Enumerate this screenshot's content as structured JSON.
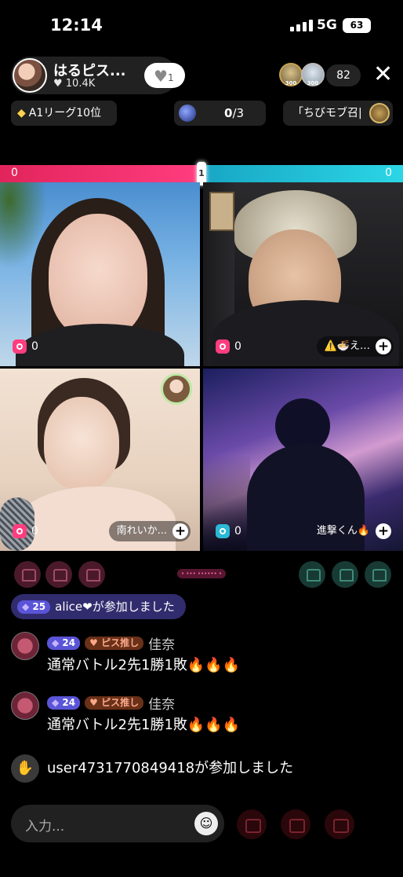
{
  "status": {
    "time": "12:14",
    "network": "5G",
    "battery": "63"
  },
  "host": {
    "name": "はるピス...",
    "likes": "♥ 10.4K",
    "follow_count": "1"
  },
  "viewers": {
    "count": "82",
    "badge1": "300",
    "badge2": "300"
  },
  "chips": {
    "league": "A1リーグ10位",
    "quest_value": "0",
    "quest_total": "/3",
    "tag": "「ちびモブ召|"
  },
  "battle": {
    "left_score": "0",
    "right_score": "0",
    "center": "1"
  },
  "tiles": [
    {
      "score": "0",
      "name": ""
    },
    {
      "score": "0",
      "name": "⚠️🍜え…"
    },
    {
      "score": "0",
      "name": "南れいか..."
    },
    {
      "score": "0",
      "name": "進撃くん🔥"
    }
  ],
  "pink_chip": "• ••• •••••• •",
  "chat": {
    "join1": {
      "level": "25",
      "text": "alice❤が参加しました"
    },
    "messages": [
      {
        "level": "24",
        "badge": "ピス推し",
        "user": "佳奈",
        "text": "通常バトル2先1勝1敗",
        "emoji": "🔥🔥🔥"
      },
      {
        "level": "24",
        "badge": "ピス推し",
        "user": "佳奈",
        "text": "通常バトル2先1勝1敗",
        "emoji": "🔥🔥🔥"
      }
    ],
    "join2": "user4731770849418が参加しました"
  },
  "input": {
    "placeholder": "入力..."
  },
  "colors": {
    "red": "#e2245c",
    "cyan": "#2bd6e6",
    "accent": "#5a55d8"
  }
}
